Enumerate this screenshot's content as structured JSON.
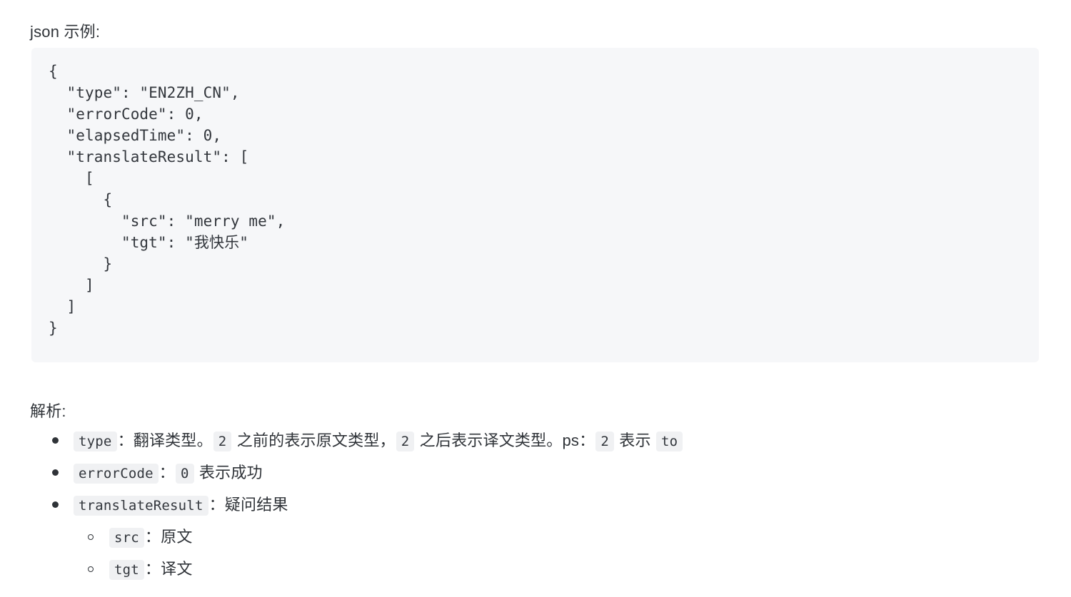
{
  "intro": {
    "text": "json 示例:"
  },
  "code_block": {
    "language": "json",
    "lines": [
      "{",
      "  \"type\": \"EN2ZH_CN\",",
      "  \"errorCode\": 0,",
      "  \"elapsedTime\": 0,",
      "  \"translateResult\": [",
      "    [",
      "      {",
      "        \"src\": \"merry me\",",
      "        \"tgt\": \"我快乐\"",
      "      }",
      "    ]",
      "  ]",
      "}"
    ],
    "background_color": "#f6f7f9",
    "text_color": "#32363c"
  },
  "analysis": {
    "heading": "解析:",
    "items": [
      {
        "parts": [
          {
            "type": "code",
            "text": "type"
          },
          {
            "type": "text",
            "text": "：翻译类型。"
          },
          {
            "type": "code",
            "text": "2"
          },
          {
            "type": "text",
            "text": " 之前的表示原文类型，"
          },
          {
            "type": "code",
            "text": "2"
          },
          {
            "type": "text",
            "text": " 之后表示译文类型。ps："
          },
          {
            "type": "code",
            "text": "2"
          },
          {
            "type": "text",
            "text": " 表示 "
          },
          {
            "type": "code",
            "text": "to"
          }
        ],
        "children": []
      },
      {
        "parts": [
          {
            "type": "code",
            "text": "errorCode"
          },
          {
            "type": "text",
            "text": "："
          },
          {
            "type": "code",
            "text": "0"
          },
          {
            "type": "text",
            "text": " 表示成功"
          }
        ],
        "children": []
      },
      {
        "parts": [
          {
            "type": "code",
            "text": "translateResult"
          },
          {
            "type": "text",
            "text": "：疑问结果"
          }
        ],
        "children": [
          {
            "parts": [
              {
                "type": "code",
                "text": "src"
              },
              {
                "type": "text",
                "text": "：原文"
              }
            ]
          },
          {
            "parts": [
              {
                "type": "code",
                "text": "tgt"
              },
              {
                "type": "text",
                "text": "：译文"
              }
            ]
          }
        ]
      }
    ]
  },
  "colors": {
    "page_background": "#ffffff",
    "body_text": "#2f3338",
    "code_chip_background": "#f0f1f3",
    "code_block_background": "#f6f7f9"
  }
}
